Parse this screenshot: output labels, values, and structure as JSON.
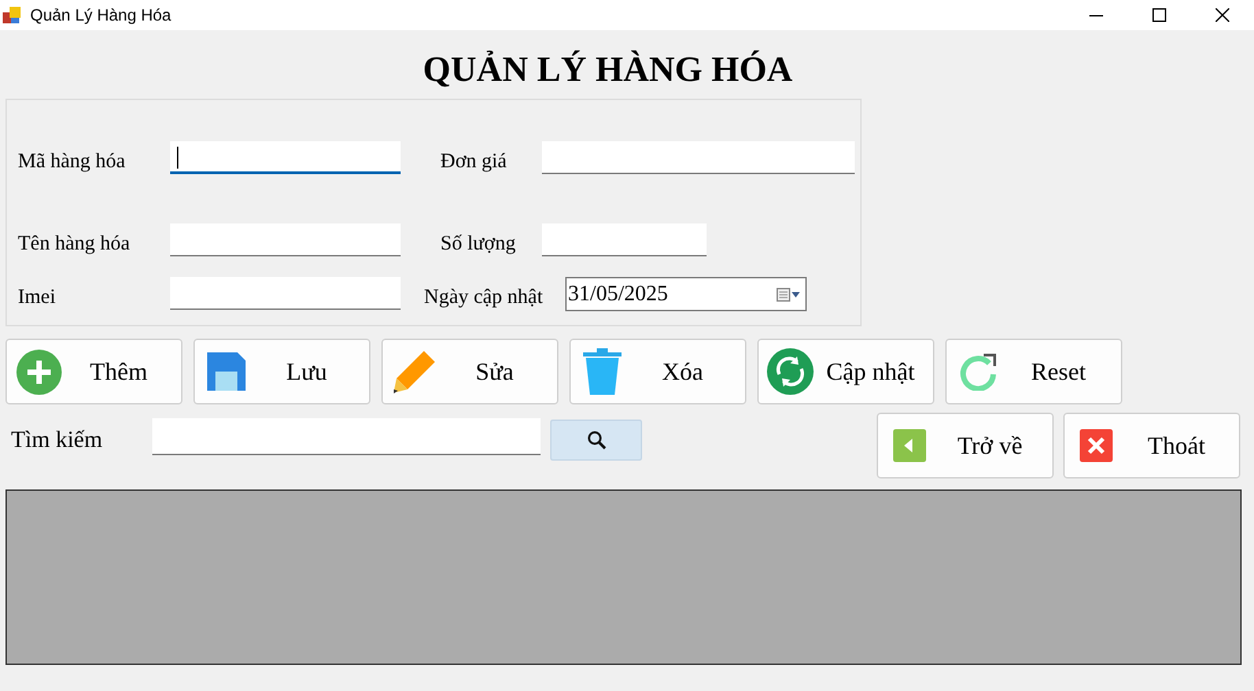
{
  "window": {
    "title": "Quản Lý Hàng Hóa"
  },
  "heading": "QUẢN LÝ HÀNG HÓA",
  "form_rows": [
    [
      {
        "label": "Mã hàng hóa",
        "kind": "text",
        "focused": true
      },
      {
        "label": "Đơn giá",
        "kind": "text",
        "focused": false
      }
    ],
    [
      {
        "label": "Tên hàng hóa",
        "kind": "text",
        "focused": false
      },
      {
        "label": "Số lượng",
        "kind": "short",
        "focused": false
      }
    ],
    [
      {
        "label": "Imei",
        "kind": "text",
        "focused": false
      },
      {
        "label": "Ngày cập nhật",
        "kind": "date",
        "value": "31/05/2025"
      }
    ]
  ],
  "actions": [
    {
      "label": "Thêm",
      "kind": "add"
    },
    {
      "label": "Lưu",
      "kind": "save"
    },
    {
      "label": "Sửa",
      "kind": "edit"
    },
    {
      "label": "Xóa",
      "kind": "delete"
    },
    {
      "label": "Cập nhật",
      "kind": "refresh"
    },
    {
      "label": "Reset",
      "kind": "reset"
    }
  ],
  "search": {
    "label": "Tìm kiếm"
  },
  "nav": [
    {
      "label": "Trở về",
      "kind": "back"
    },
    {
      "label": "Thoát",
      "kind": "exit"
    }
  ]
}
